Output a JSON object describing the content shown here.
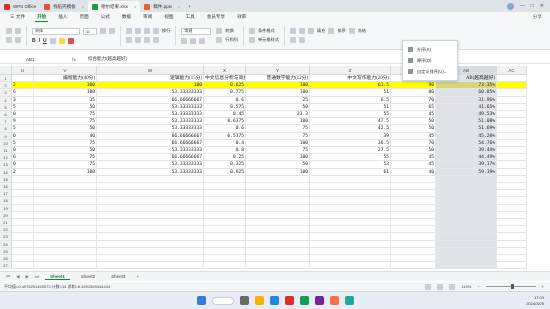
{
  "tabs": [
    {
      "label": "WPS Office",
      "color": "#d93025",
      "active": false
    },
    {
      "label": "找稻壳模板",
      "color": "#e74c3c",
      "active": false
    },
    {
      "label": "德尔结果.xlsx",
      "color": "#1a9d4b",
      "active": true
    },
    {
      "label": "稿件.pptx",
      "color": "#e8622c",
      "active": false
    }
  ],
  "menu": {
    "items": [
      "三 文件",
      "开始",
      "插入",
      "页面",
      "公式",
      "数据",
      "审阅",
      "视图",
      "工具",
      "会员专享",
      "效率"
    ],
    "active_index": 1,
    "right": [
      "分享"
    ]
  },
  "ribbon": {
    "font": "宋体",
    "size": "11",
    "wrap": "换行",
    "format": "常规",
    "convert": "转换",
    "rows_cols": "行和列",
    "conditional": "条件格式",
    "cell_style": "单元格样式",
    "fill": "填充",
    "sort": "排序",
    "freeze": "冻结"
  },
  "dropdown": {
    "items": [
      "升序(S)",
      "降序(O)",
      "自定义排序(U)..."
    ]
  },
  "formula_bar": {
    "name_box": "AB1",
    "fx": "fx",
    "content": "综合能力(越高越好)"
  },
  "grid": {
    "columns": [
      "U",
      "V",
      "W",
      "X",
      "Y",
      "Z",
      "AA",
      "AB",
      "AC"
    ],
    "selected_column": "AB",
    "header_row": [
      "编程能力(40分)",
      "逻辑能力(15分)",
      "中文信息分析与简报能力(80分)",
      "普通数学能力(12分)",
      "中文写作能力(20分)",
      "英文写作能力",
      "AB(越高越好)"
    ],
    "rows": [
      [
        "2",
        "100",
        "100",
        "0.625",
        "100",
        "61.5",
        "90",
        "73.35%"
      ],
      [
        "6",
        "100",
        "53.33333333",
        "0.775",
        "100",
        "51",
        "80",
        "60.85%"
      ],
      [
        "3",
        "35",
        "66.66666667",
        "0.6",
        "25",
        "6.5",
        "70",
        "31.96%"
      ],
      [
        "5",
        "50",
        "53.33333333",
        "0.575",
        "50",
        "51",
        "65",
        "41.65%"
      ],
      [
        "0",
        "75",
        "53.33333333",
        "0.45",
        "33.3",
        "55",
        "45",
        "49.53%"
      ],
      [
        "9",
        "75",
        "53.33333333",
        "0.6375",
        "100",
        "47.5",
        "50",
        "51.08%"
      ],
      [
        "5",
        "50",
        "53.33333333",
        "0.6",
        "75",
        "42.5",
        "50",
        "51.69%"
      ],
      [
        "0",
        "40",
        "66.66666667",
        "0.5375",
        "75",
        "39",
        "45",
        "45.20%"
      ],
      [
        "5",
        "75",
        "66.66666667",
        "0.4",
        "100",
        "36.5",
        "70",
        "54.76%"
      ],
      [
        "0",
        "50",
        "53.33333333",
        "0.8",
        "75",
        "27.5",
        "50",
        "39.44%"
      ],
      [
        "6",
        "75",
        "66.66666667",
        "0.25",
        "100",
        "55",
        "45",
        "44.49%"
      ],
      [
        "0",
        "75",
        "53.33333333",
        "0.325",
        "50",
        "53",
        "45",
        "39.17%"
      ],
      [
        "2",
        "100",
        "53.33333333",
        "0.925",
        "100",
        "61",
        "40",
        "59.19%"
      ]
    ],
    "row_numbers": [
      "1",
      "2",
      "3",
      "4",
      "5",
      "6",
      "7",
      "8",
      "9",
      "10",
      "11",
      "12",
      "13",
      "14",
      "15",
      "16",
      "17",
      "18",
      "19",
      "20",
      "21",
      "22",
      "23",
      "24",
      "25",
      "26",
      "27"
    ]
  },
  "sheets": [
    "Sheet1",
    "Sheet2",
    "Sheet3"
  ],
  "status": {
    "stats": "平均值=0.4976251469573 计数=14 求和=6.4692569444444",
    "zoom": "115%"
  },
  "tray": {
    "time": "17:03",
    "date": "2024/3/25"
  },
  "colors": {
    "accent": "#1a7f37",
    "highlight": "#ffff00"
  }
}
